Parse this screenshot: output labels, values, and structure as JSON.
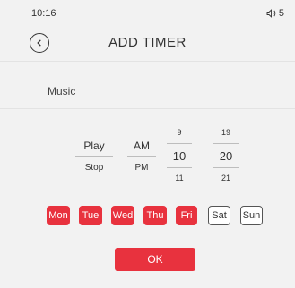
{
  "status_bar": {
    "time": "10:16",
    "volume_level": "5",
    "volume_icon": "speaker-icon"
  },
  "header": {
    "title": "ADD TIMER",
    "back_icon": "chevron-left-icon"
  },
  "music": {
    "label": "Music"
  },
  "pickers": {
    "action": {
      "selected": "Play",
      "next": "Stop"
    },
    "meridiem": {
      "selected": "AM",
      "next": "PM"
    },
    "hour": {
      "prev": "9",
      "selected": "10",
      "next": "11"
    },
    "minute": {
      "prev": "19",
      "selected": "20",
      "next": "21"
    }
  },
  "days": [
    {
      "label": "Mon",
      "active": true
    },
    {
      "label": "Tue",
      "active": true
    },
    {
      "label": "Wed",
      "active": true
    },
    {
      "label": "Thu",
      "active": true
    },
    {
      "label": "Fri",
      "active": true
    },
    {
      "label": "Sat",
      "active": false
    },
    {
      "label": "Sun",
      "active": false
    }
  ],
  "ok_label": "OK",
  "colors": {
    "accent": "#e8323e",
    "background": "#f2f2f2",
    "text": "#333333"
  }
}
